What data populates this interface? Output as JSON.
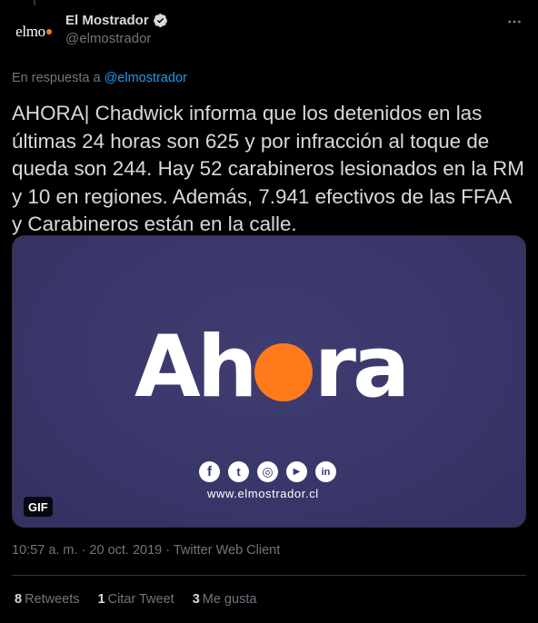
{
  "author": {
    "avatar_text": "elmo",
    "display_name": "El Mostrador",
    "handle": "@elmostrador",
    "verified": true
  },
  "reply": {
    "prefix": "En respuesta a",
    "handle": "@elmostrador"
  },
  "tweet": {
    "text": "AHORA| Chadwick informa que los detenidos en las últimas 24 horas son 625 y por infracción al toque de queda son 244. Hay 52 carabineros lesionados en la RM y 10 en regiones. Además, 7.941 efectivos de las FFAA y Carabineros están en la calle."
  },
  "media": {
    "title_start": "Ah",
    "title_end": "ra",
    "social_icons": [
      "facebook-icon",
      "twitter-icon",
      "instagram-icon",
      "youtube-icon",
      "linkedin-icon"
    ],
    "social_glyphs": [
      "f",
      "t",
      "◎",
      "▶",
      "in"
    ],
    "website": "www.elmostrador.cl",
    "badge": "GIF"
  },
  "meta": {
    "line": "10:57 a. m. · 20 oct. 2019 · Twitter Web Client"
  },
  "stats": {
    "retweets_count": "8",
    "retweets_label": "Retweets",
    "quotes_count": "1",
    "quotes_label": "Citar Tweet",
    "likes_count": "3",
    "likes_label": "Me gusta"
  },
  "colors": {
    "background": "#000000",
    "text": "#d9d9d9",
    "muted": "#6e767d",
    "link": "#1d9bf0",
    "media_bg": "#3a386b",
    "brand_orange": "#ff7a1a"
  }
}
